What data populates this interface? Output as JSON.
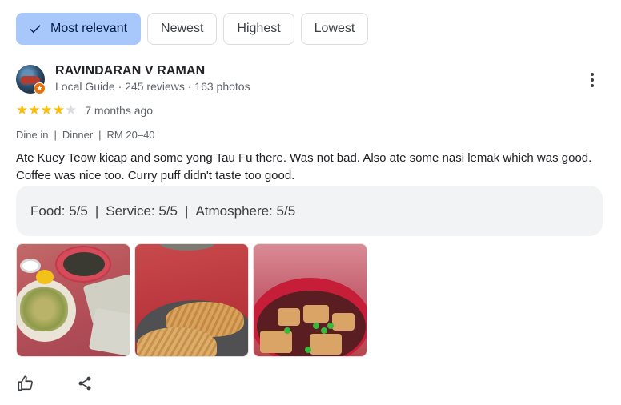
{
  "sort_chips": [
    {
      "label": "Most relevant",
      "selected": true
    },
    {
      "label": "Newest",
      "selected": false
    },
    {
      "label": "Highest",
      "selected": false
    },
    {
      "label": "Lowest",
      "selected": false
    }
  ],
  "review": {
    "reviewer_name": "RAVINDARAN V RAMAN",
    "reviewer_meta": "Local Guide · 245 reviews · 163 photos",
    "rating": 4,
    "max_rating": 5,
    "time_ago": "7 months ago",
    "tags": [
      "Dine in",
      "Dinner",
      "RM 20–40"
    ],
    "text": "Ate Kuey Teow kicap and some yong Tau Fu there. Was not bad. Also ate some nasi lemak which was good. Coffee was nice too. Curry puff didn't taste too good.",
    "attributes": [
      "Food: 5/5",
      "Service: 5/5",
      "Atmosphere: 5/5"
    ],
    "photos": [
      "noodle-dishes-photo",
      "curry-puff-photo",
      "yong-tau-fu-soup-photo"
    ]
  },
  "icons": {
    "selected_chip": "check-icon",
    "more": "more-vert-icon",
    "badge": "local-guide-icon",
    "like": "thumbs-up-icon",
    "share": "share-icon"
  },
  "colors": {
    "selected_chip_bg": "#a8c7fa",
    "star": "#fbbc04",
    "badge": "#e8710a",
    "attribute_box": "#f1f3f4"
  }
}
